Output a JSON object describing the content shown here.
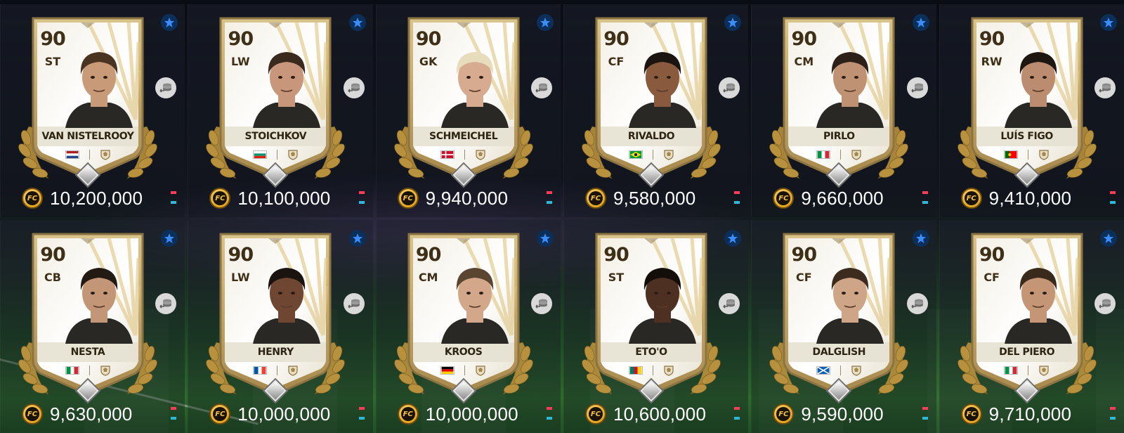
{
  "colors": {
    "trend_up": "#ff3b5a",
    "trend_down": "#2bb8d9",
    "coin": "#e3a723",
    "card_text": "#3e2f16"
  },
  "coin_label": "FC",
  "cards": [
    {
      "rating": "90",
      "position": "ST",
      "name": "VAN NISTELROOY",
      "flag": "netherlands-flag-icon",
      "price": "10,200,000",
      "hair": "#4a3320",
      "skin": "#c99a78",
      "flag_colors": [
        "#ae1c28",
        "#ffffff",
        "#21468b"
      ],
      "flag_style": "h3",
      "star": true
    },
    {
      "rating": "90",
      "position": "LW",
      "name": "STOICHKOV",
      "flag": "bulgaria-flag-icon",
      "price": "10,100,000",
      "hair": "#3a2a1e",
      "skin": "#c8967a",
      "flag_colors": [
        "#ffffff",
        "#00966e",
        "#d62612"
      ],
      "flag_style": "h3",
      "star": true
    },
    {
      "rating": "90",
      "position": "GK",
      "name": "SCHMEICHEL",
      "flag": "denmark-flag-icon",
      "price": "9,940,000",
      "hair": "#e7dcbc",
      "skin": "#d7ab90",
      "flag_colors": [
        "#c8102e",
        "#ffffff"
      ],
      "flag_style": "cross",
      "star": true
    },
    {
      "rating": "90",
      "position": "CF",
      "name": "RIVALDO",
      "flag": "brazil-flag-icon",
      "price": "9,580,000",
      "hair": "#1c1410",
      "skin": "#8a5a3e",
      "flag_colors": [
        "#009c3b",
        "#ffdf00",
        "#002776"
      ],
      "flag_style": "brazil",
      "star": true
    },
    {
      "rating": "90",
      "position": "CM",
      "name": "PIRLO",
      "flag": "italy-flag-icon",
      "price": "9,660,000",
      "hair": "#2c2018",
      "skin": "#bf9274",
      "flag_colors": [
        "#009246",
        "#ffffff",
        "#ce2b37"
      ],
      "flag_style": "v3",
      "star": true
    },
    {
      "rating": "90",
      "position": "RW",
      "name": "LUÍS FIGO",
      "flag": "portugal-flag-icon",
      "price": "9,410,000",
      "hair": "#1e1610",
      "skin": "#bb8c70",
      "flag_colors": [
        "#006600",
        "#ff0000"
      ],
      "flag_style": "portugal",
      "star": true
    },
    {
      "rating": "90",
      "position": "CB",
      "name": "NESTA",
      "flag": "italy-flag-icon",
      "price": "9,630,000",
      "hair": "#241a14",
      "skin": "#c39678",
      "flag_colors": [
        "#009246",
        "#ffffff",
        "#ce2b37"
      ],
      "flag_style": "v3",
      "star": true
    },
    {
      "rating": "90",
      "position": "LW",
      "name": "HENRY",
      "flag": "france-flag-icon",
      "price": "10,000,000",
      "hair": "#1a1310",
      "skin": "#6e4632",
      "flag_colors": [
        "#0055a4",
        "#ffffff",
        "#ef4135"
      ],
      "flag_style": "v3",
      "star": true
    },
    {
      "rating": "90",
      "position": "CM",
      "name": "KROOS",
      "flag": "germany-flag-icon",
      "price": "10,000,000",
      "hair": "#5a4530",
      "skin": "#d3a88a",
      "flag_colors": [
        "#000000",
        "#dd0000",
        "#ffce00"
      ],
      "flag_style": "h3",
      "star": true
    },
    {
      "rating": "90",
      "position": "ST",
      "name": "ETO'O",
      "flag": "cameroon-flag-icon",
      "price": "10,600,000",
      "hair": "#140e0a",
      "skin": "#4e3022",
      "flag_colors": [
        "#007a5e",
        "#ce1126",
        "#fcd116"
      ],
      "flag_style": "v3",
      "star": true
    },
    {
      "rating": "90",
      "position": "CF",
      "name": "DALGLISH",
      "flag": "scotland-flag-icon",
      "price": "9,590,000",
      "hair": "#3d2c1e",
      "skin": "#cfa588",
      "flag_colors": [
        "#005eb8",
        "#ffffff"
      ],
      "flag_style": "saltire",
      "star": true
    },
    {
      "rating": "90",
      "position": "CF",
      "name": "DEL PIERO",
      "flag": "italy-flag-icon",
      "price": "9,710,000",
      "hair": "#3a2a1c",
      "skin": "#c49676",
      "flag_colors": [
        "#009246",
        "#ffffff",
        "#ce2b37"
      ],
      "flag_style": "v3",
      "star": true
    }
  ]
}
